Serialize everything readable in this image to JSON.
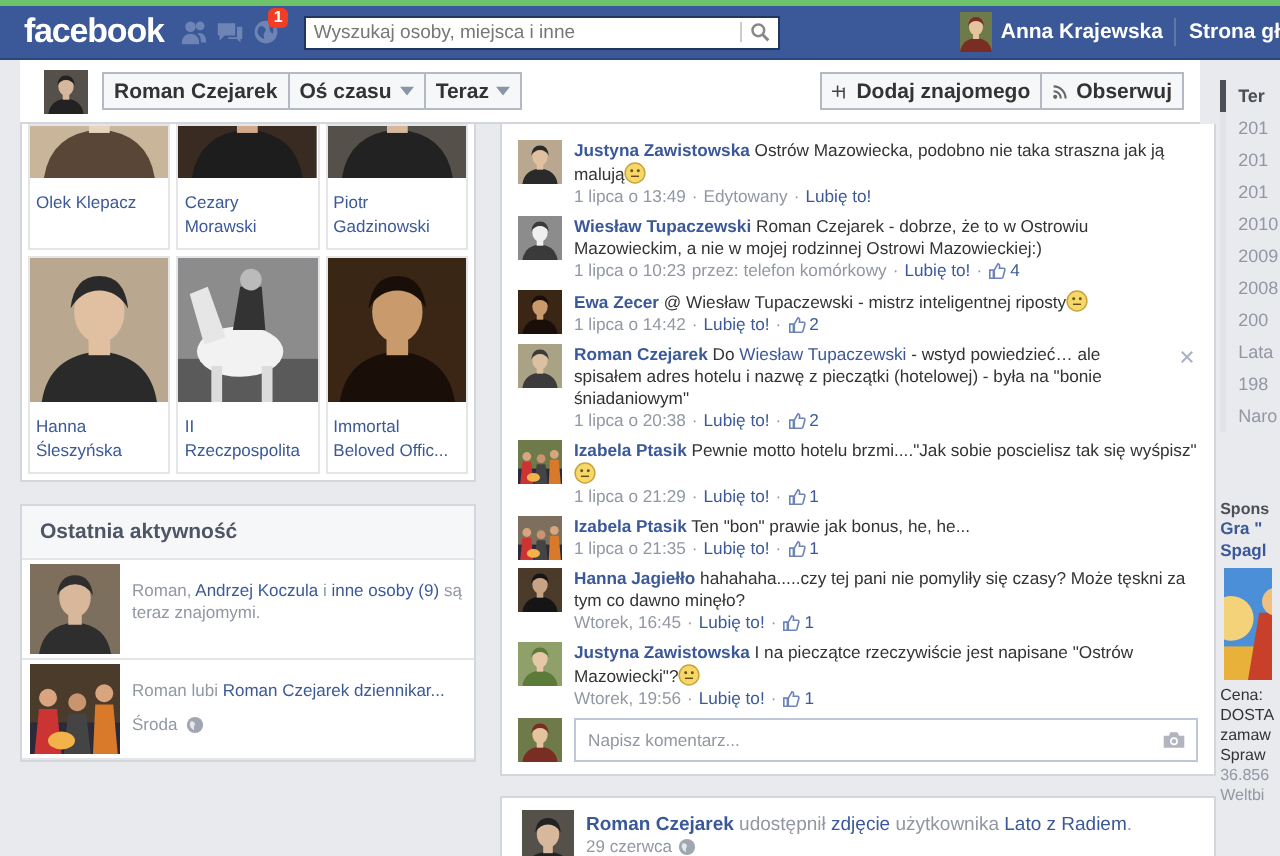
{
  "topbar": {
    "logo": "facebook",
    "notification_count": "1",
    "search": {
      "placeholder": "Wyszukaj osoby, miejsca i inne"
    },
    "user_name": "Anna Krajewska",
    "home_link": "Strona gł"
  },
  "profile_bar": {
    "name_button": "Roman Czejarek",
    "menus": [
      {
        "label": "Oś czasu"
      },
      {
        "label": "Teraz"
      }
    ],
    "actions": [
      {
        "kind": "add-friend",
        "label": "Dodaj znajomego"
      },
      {
        "kind": "follow",
        "label": "Obserwuj"
      }
    ]
  },
  "photo_grid": [
    {
      "label": "Olek Klepacz"
    },
    {
      "label": "Cezary Morawski"
    },
    {
      "label": "Piotr Gadzinowski"
    },
    {
      "label": "Hanna Śleszyńska"
    },
    {
      "label": "II Rzeczpospolita"
    },
    {
      "label": "Immortal Beloved Offic..."
    }
  ],
  "recent_activity": {
    "title": "Ostatnia aktywność",
    "items": [
      {
        "parts": [
          {
            "text": "Roman, ",
            "kind": "text"
          },
          {
            "text": "Andrzej Koczula",
            "kind": "link"
          },
          {
            "text": " i ",
            "kind": "text"
          },
          {
            "text": "inne osoby (9)",
            "kind": "link"
          },
          {
            "text": " są teraz znajomymi.",
            "kind": "text"
          }
        ]
      },
      {
        "parts": [
          {
            "text": "Roman lubi ",
            "kind": "text"
          },
          {
            "text": "Roman Czejarek dziennikar...",
            "kind": "link"
          }
        ],
        "time": "Środa"
      }
    ]
  },
  "comments": [
    {
      "author": "Justyna Zawistowska",
      "parts": [
        {
          "text": "Ostrów Mazowiecka, podobno nie taka straszna jak ją malują",
          "kind": "text"
        }
      ],
      "smiley": true,
      "closable": false,
      "meta": [
        {
          "kind": "time",
          "text": "1 lipca o 13:49"
        },
        {
          "kind": "sep",
          "text": "·"
        },
        {
          "kind": "note",
          "text": "Edytowany"
        },
        {
          "kind": "sep",
          "text": "·"
        },
        {
          "kind": "link",
          "text": "Lubię to!"
        }
      ]
    },
    {
      "author": "Wiesław Tupaczewski",
      "parts": [
        {
          "text": "Roman Czejarek - dobrze, że to w Ostrowiu Mazowieckim, a nie w mojej rodzinnej Ostrowi Mazowieckiej:)",
          "kind": "text"
        }
      ],
      "smiley": false,
      "closable": false,
      "meta": [
        {
          "kind": "time",
          "text": "1 lipca o 10:23"
        },
        {
          "kind": "note",
          "text": "przez: telefon komórkowy"
        },
        {
          "kind": "sep",
          "text": "·"
        },
        {
          "kind": "link",
          "text": "Lubię to!"
        },
        {
          "kind": "sep",
          "text": "·"
        },
        {
          "kind": "likes",
          "text": "4"
        }
      ]
    },
    {
      "author": "Ewa Zecer",
      "parts": [
        {
          "text": "@ Wiesław Tupaczewski - mistrz inteligentnej riposty",
          "kind": "text"
        }
      ],
      "smiley": true,
      "closable": false,
      "meta": [
        {
          "kind": "time",
          "text": "1 lipca o 14:42"
        },
        {
          "kind": "sep",
          "text": "·"
        },
        {
          "kind": "link",
          "text": "Lubię to!"
        },
        {
          "kind": "sep",
          "text": "·"
        },
        {
          "kind": "likes",
          "text": "2"
        }
      ]
    },
    {
      "author": "Roman Czejarek",
      "parts": [
        {
          "text": "Do ",
          "kind": "text"
        },
        {
          "text": "Wiesław Tupaczewski",
          "kind": "link"
        },
        {
          "text": " - wstyd powiedzieć… ale spisałem adres hotelu i nazwę z pieczątki (hotelowej) - była na \"bonie śniadaniowym\"",
          "kind": "text"
        }
      ],
      "smiley": false,
      "closable": true,
      "meta": [
        {
          "kind": "time",
          "text": "1 lipca o 20:38"
        },
        {
          "kind": "sep",
          "text": "·"
        },
        {
          "kind": "link",
          "text": "Lubię to!"
        },
        {
          "kind": "sep",
          "text": "·"
        },
        {
          "kind": "likes",
          "text": "2"
        }
      ]
    },
    {
      "author": "Izabela Ptasik",
      "parts": [
        {
          "text": "Pewnie motto hotelu brzmi....\"Jak sobie poscielisz tak się wyśpisz\"",
          "kind": "text"
        }
      ],
      "smiley": true,
      "closable": false,
      "meta": [
        {
          "kind": "time",
          "text": "1 lipca o 21:29"
        },
        {
          "kind": "sep",
          "text": "·"
        },
        {
          "kind": "link",
          "text": "Lubię to!"
        },
        {
          "kind": "sep",
          "text": "·"
        },
        {
          "kind": "likes",
          "text": "1"
        }
      ]
    },
    {
      "author": "Izabela Ptasik",
      "parts": [
        {
          "text": "Ten \"bon\" prawie jak bonus, he, he...",
          "kind": "text"
        }
      ],
      "smiley": false,
      "closable": false,
      "meta": [
        {
          "kind": "time",
          "text": "1 lipca o 21:35"
        },
        {
          "kind": "sep",
          "text": "·"
        },
        {
          "kind": "link",
          "text": "Lubię to!"
        },
        {
          "kind": "sep",
          "text": "·"
        },
        {
          "kind": "likes",
          "text": "1"
        }
      ]
    },
    {
      "author": "Hanna Jagiełło",
      "parts": [
        {
          "text": "hahahaha.....czy tej pani nie pomyliły się czasy? Może tęskni za tym co dawno minęło?",
          "kind": "text"
        }
      ],
      "smiley": false,
      "closable": false,
      "meta": [
        {
          "kind": "time",
          "text": "Wtorek, 16:45"
        },
        {
          "kind": "sep",
          "text": "·"
        },
        {
          "kind": "link",
          "text": "Lubię to!"
        },
        {
          "kind": "sep",
          "text": "·"
        },
        {
          "kind": "likes",
          "text": "1"
        }
      ]
    },
    {
      "author": "Justyna Zawistowska",
      "parts": [
        {
          "text": "I na pieczątce rzeczywiście jest napisane \"Ostrów Mazowiecki\"?",
          "kind": "text"
        }
      ],
      "smiley": true,
      "closable": false,
      "meta": [
        {
          "kind": "time",
          "text": "Wtorek, 19:56"
        },
        {
          "kind": "sep",
          "text": "·"
        },
        {
          "kind": "link",
          "text": "Lubię to!"
        },
        {
          "kind": "sep",
          "text": "·"
        },
        {
          "kind": "likes",
          "text": "1"
        }
      ]
    }
  ],
  "comment_box": {
    "placeholder": "Napisz komentarz..."
  },
  "next_post": {
    "parts": [
      {
        "text": "Roman Czejarek",
        "kind": "bold-link"
      },
      {
        "text": " udostępnił ",
        "kind": "text"
      },
      {
        "text": "zdjęcie",
        "kind": "link"
      },
      {
        "text": " użytkownika ",
        "kind": "text"
      },
      {
        "text": "Lato z Radiem",
        "kind": "link"
      },
      {
        "text": ".",
        "kind": "text"
      }
    ],
    "time": "29 czerwca"
  },
  "timeline_nav": [
    {
      "label": "Ter",
      "selected": true
    },
    {
      "label": "201",
      "selected": false
    },
    {
      "label": "201",
      "selected": false
    },
    {
      "label": "201",
      "selected": false
    },
    {
      "label": "2010",
      "selected": false
    },
    {
      "label": "2009",
      "selected": false
    },
    {
      "label": "2008",
      "selected": false
    },
    {
      "label": "200",
      "selected": false
    },
    {
      "label": "Lata",
      "selected": false
    },
    {
      "label": "198",
      "selected": false
    },
    {
      "label": "Naro",
      "selected": false
    }
  ],
  "sponsored": {
    "heading": "Spons",
    "title_lines": [
      "Gra \"",
      "Spagl"
    ],
    "lines": [
      "Cena:",
      "DOSTA",
      "zamaw",
      "Spraw"
    ],
    "footer_lines": [
      "36.856",
      "Weltbi"
    ]
  }
}
